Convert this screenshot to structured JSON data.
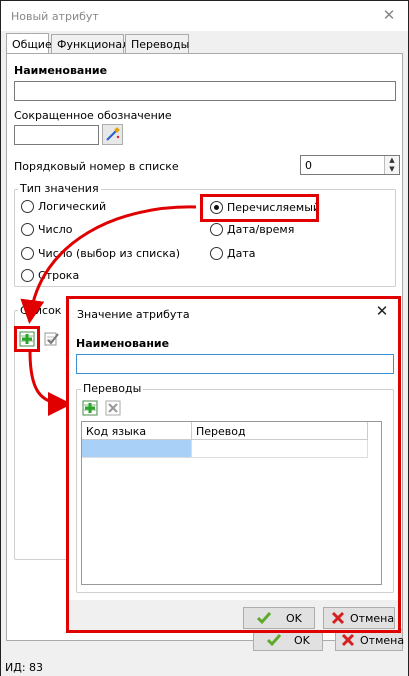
{
  "window": {
    "title": "Новый атрибут",
    "close_glyph": "✕",
    "tabs": [
      {
        "label": "Общие",
        "active": true
      },
      {
        "label": "Функционал",
        "active": false
      },
      {
        "label": "Переводы",
        "active": false
      }
    ]
  },
  "general": {
    "name_label": "Наименование",
    "name_value": "",
    "short_label": "Сокращенное обозначение",
    "short_value": "",
    "order_label": "Порядковый номер в списке",
    "order_value": "0",
    "value_type": {
      "title": "Тип значения",
      "options": [
        {
          "label": "Логический",
          "selected": false
        },
        {
          "label": "Число",
          "selected": false
        },
        {
          "label": "Число (выбор из списка)",
          "selected": false
        },
        {
          "label": "Строка",
          "selected": false
        },
        {
          "label": "Перечисляемый",
          "selected": true
        },
        {
          "label": "Дата/время",
          "selected": false
        },
        {
          "label": "Дата",
          "selected": false
        }
      ]
    },
    "list_group_title": "Список в"
  },
  "footer": {
    "ok_label": "OK",
    "cancel_label": "Отмена",
    "status_text": "ИД: 83"
  },
  "dialog": {
    "title": "Значение атрибута",
    "close_glyph": "✕",
    "name_label": "Наименование",
    "name_value": "",
    "translations_title": "Переводы",
    "columns": [
      "Код языка",
      "Перевод"
    ],
    "rows": [
      {
        "lang_code": "",
        "translation": ""
      }
    ],
    "ok_label": "OK",
    "cancel_label": "Отмена"
  },
  "colors": {
    "highlight": "#e00000",
    "selected_row": "#a9d1f7",
    "input_focus_border": "#3c8fd6",
    "ok_check": "#5fa92a",
    "cancel_x": "#d52020",
    "add_icon_green": "#2aa52a"
  }
}
